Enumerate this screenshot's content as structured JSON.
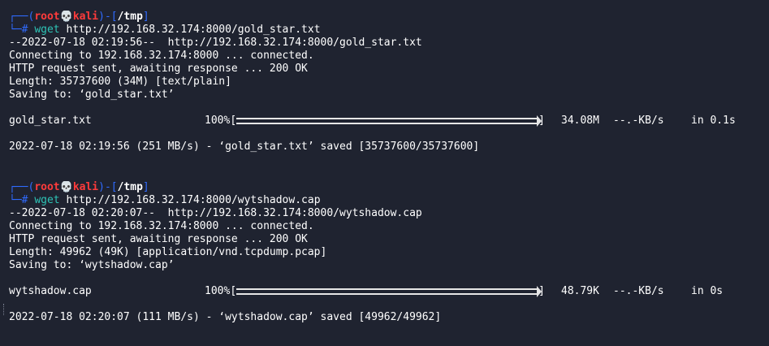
{
  "prompt": {
    "user": "root",
    "host": "kali",
    "skull": "💀",
    "path": "/tmp",
    "hash": "#"
  },
  "sessions": [
    {
      "command": "wget",
      "argument": "http://192.168.32.174:8000/gold_star.txt",
      "output": [
        "--2022-07-18 02:19:56--  http://192.168.32.174:8000/gold_star.txt",
        "Connecting to 192.168.32.174:8000 ... connected.",
        "HTTP request sent, awaiting response ... 200 OK",
        "Length: 35737600 (34M) [text/plain]",
        "Saving to: ‘gold_star.txt’"
      ],
      "progress": {
        "filename": "gold_star.txt",
        "percent": "100%",
        "size": "34.08M",
        "rate": "--.-KB/s",
        "eta": "in 0.1s"
      },
      "saved": "2022-07-18 02:19:56 (251 MB/s) - ‘gold_star.txt’ saved [35737600/35737600]"
    },
    {
      "command": "wget",
      "argument": "http://192.168.32.174:8000/wytshadow.cap",
      "output": [
        "--2022-07-18 02:20:07--  http://192.168.32.174:8000/wytshadow.cap",
        "Connecting to 192.168.32.174:8000 ... connected.",
        "HTTP request sent, awaiting response ... 200 OK",
        "Length: 49962 (49K) [application/vnd.tcpdump.pcap]",
        "Saving to: ‘wytshadow.cap’"
      ],
      "progress": {
        "filename": "wytshadow.cap",
        "percent": "100%",
        "size": "48.79K",
        "rate": "--.-KB/s",
        "eta": "in 0s"
      },
      "saved": "2022-07-18 02:20:07 (111 MB/s) - ‘wytshadow.cap’ saved [49962/49962]"
    }
  ]
}
